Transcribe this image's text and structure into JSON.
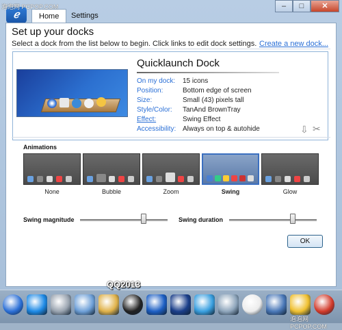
{
  "watermark": {
    "top": "泡泡网 PCPOP.COM",
    "bottom": "泡泡网 PCPOP.COM"
  },
  "tabs": [
    {
      "label": "Home",
      "active": true
    },
    {
      "label": "Settings",
      "active": false
    }
  ],
  "window_buttons": {
    "minimize": "–",
    "maximize": "□",
    "close": "✕"
  },
  "header": {
    "title": "Set up your docks",
    "subtitle": "Select a dock from the list below to begin. Click links to edit dock settings.",
    "create_link": "Create a new dock..."
  },
  "dock": {
    "name": "Quicklaunch Dock",
    "properties": [
      {
        "key": "On my dock:",
        "value": "15 icons",
        "link": false
      },
      {
        "key": "Position:",
        "value": "Bottom edge of screen",
        "link": false
      },
      {
        "key": "Size:",
        "value": "Small (43) pixels tall",
        "link": false
      },
      {
        "key": "Style/Color:",
        "value": "TanAnd BrownTray",
        "link": false
      },
      {
        "key": "Effect:",
        "value": "Swing Effect",
        "link": true
      },
      {
        "key": "Accessibility:",
        "value": "Always on top & autohide",
        "link": false
      }
    ]
  },
  "animations": {
    "label": "Animations",
    "options": [
      {
        "label": "None",
        "selected": false
      },
      {
        "label": "Bubble",
        "selected": false
      },
      {
        "label": "Zoom",
        "selected": false
      },
      {
        "label": "Swing",
        "selected": true
      },
      {
        "label": "Glow",
        "selected": false
      }
    ]
  },
  "sliders": {
    "magnitude": {
      "label": "Swing magnitude",
      "value_fraction": 0.73
    },
    "duration": {
      "label": "Swing duration",
      "value_fraction": 0.73
    }
  },
  "ok_label": "OK",
  "taskbar": {
    "overlay_text": "QQ2013",
    "items": [
      "start-orb-icon",
      "ie-icon",
      "calculator-icon",
      "notepad-icon",
      "folder-icon",
      "qq-icon",
      "media-icon",
      "photoshop-icon",
      "bird-icon",
      "recycle-bin-icon",
      "clock-icon",
      "network-icon",
      "person-icon",
      "power-icon"
    ]
  }
}
